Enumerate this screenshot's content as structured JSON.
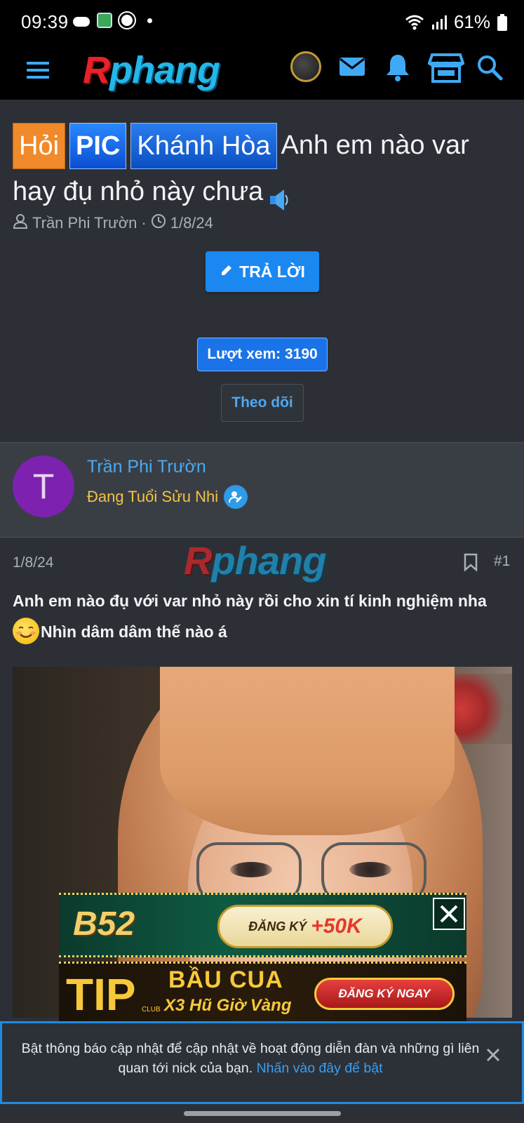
{
  "status_bar": {
    "time": "09:39",
    "battery": "61%"
  },
  "header": {
    "logo_r": "R",
    "logo_rest": "phang",
    "icons": [
      "menu-icon",
      "avatar",
      "mail-icon",
      "bell-icon",
      "store-icon",
      "search-icon"
    ]
  },
  "thread": {
    "tags": [
      "Hỏi",
      "PIC",
      "Khánh Hòa"
    ],
    "title": "Anh em nào var hay đụ nhỏ này chưa",
    "author": "Trần Phi Trườn",
    "date": "1/8/24",
    "reply_label": "TRẢ LỜI",
    "views_label": "Lượt xem: 3190",
    "follow_label": "Theo dõi"
  },
  "user": {
    "avatar_letter": "T",
    "name": "Trần Phi Trườn",
    "rank": "Đang Tuổi Sửu Nhi"
  },
  "post": {
    "date": "1/8/24",
    "number": "#1",
    "watermark_r": "R",
    "watermark_rest": "phang",
    "text_line1": "Anh em nào đụ với var nhỏ này rồi cho xin tí kinh nghiệm nha",
    "text_line2": "Nhìn dâm dâm thế nào á"
  },
  "ads": {
    "ad1_brand": "B52",
    "ad1_cta": "ĐĂNG KÝ",
    "ad1_bonus": "+50K",
    "ad2_brand": "TIP",
    "ad2_club": "CLUB",
    "ad2_title": "BẦU CUA",
    "ad2_sub": "X3 Hũ Giờ Vàng",
    "ad2_cta": "ĐĂNG KÝ NGAY"
  },
  "notification": {
    "message": "Bật thông báo cập nhật để cập nhật về hoạt động diễn đàn và những gì liên quan tới nick của bạn.",
    "link": "Nhấn vào đây để bật"
  },
  "colors": {
    "accent": "#1a88f0",
    "tag_hoi": "#f08a2a",
    "rank": "#f5c242",
    "username": "#4ba9f0"
  }
}
